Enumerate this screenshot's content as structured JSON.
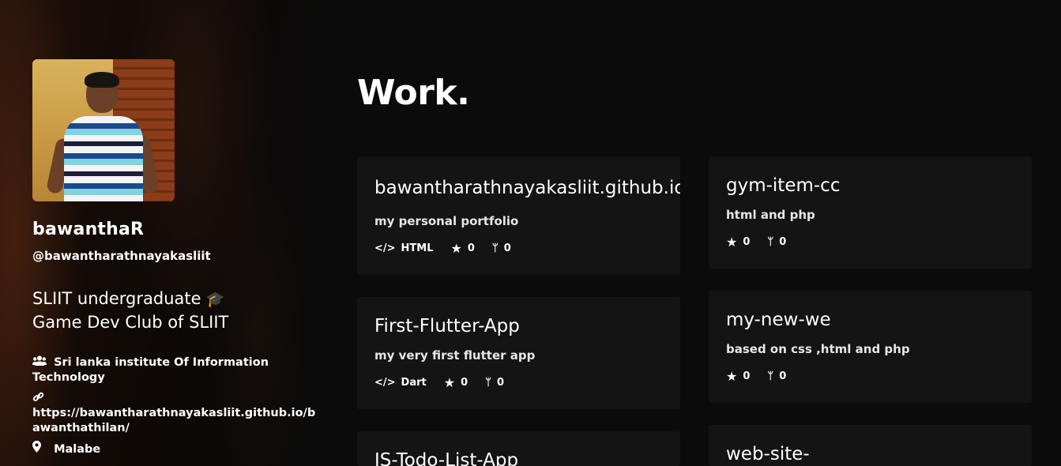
{
  "profile": {
    "name": "bawanthaR",
    "handle": "@bawantharathnayakasliit",
    "bio_line1": "SLIIT undergraduate",
    "bio_emoji": "🎓",
    "bio_line2": "Game Dev Club of SLIIT",
    "org": "Sri lanka institute Of Information Technology",
    "link": "https://bawantharathnayakasliit.github.io/bawanthathilan/",
    "location": "Malabe"
  },
  "icons": {
    "users": "users-icon",
    "link": "link-icon",
    "location": "map-marker-icon",
    "code": "code-icon",
    "star": "star-icon",
    "fork": "fork-icon"
  },
  "work": {
    "title": "Work.",
    "cards": [
      {
        "title": "bawantharathnayakasliit.github.io",
        "desc": "my personal portfolio",
        "language": "HTML",
        "stars": "0",
        "forks": "0"
      },
      {
        "title": "gym-item-cc",
        "desc": "html and php",
        "language": "",
        "stars": "0",
        "forks": "0"
      },
      {
        "title": "First-Flutter-App",
        "desc": "my very first flutter app",
        "language": "Dart",
        "stars": "0",
        "forks": "0"
      },
      {
        "title": "my-new-we",
        "desc": "based on css ,html and php",
        "language": "",
        "stars": "0",
        "forks": "0"
      },
      {
        "title": "JS-Todo-List-App",
        "desc": "",
        "language": "",
        "stars": "",
        "forks": ""
      },
      {
        "title": "web-site-",
        "desc": "",
        "language": "",
        "stars": "",
        "forks": ""
      }
    ]
  },
  "colors": {
    "background": "#0b0b0b",
    "card": "#141414",
    "text": "#ffffff"
  }
}
